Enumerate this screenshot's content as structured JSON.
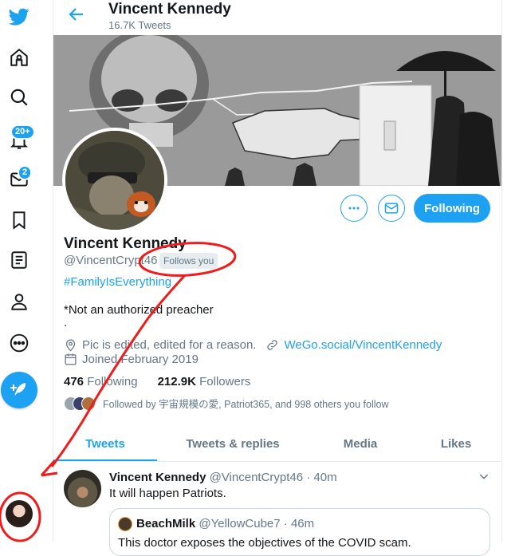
{
  "nav": {
    "notifications_badge": "20+",
    "messages_badge": "2"
  },
  "header": {
    "name": "Vincent Kennedy",
    "tweet_count": "16.7K Tweets"
  },
  "profile": {
    "name": "Vincent Kennedy",
    "handle": "@VincentCrypt46",
    "follows_you": "Follows you",
    "following_button": "Following",
    "hashtag": "#FamilyIsEverything",
    "bio_line1": "*Not an authorized preacher",
    "bio_line2": ".",
    "location": "Pic is edited, edited for a reason.",
    "website": "WeGo.social/VincentKennedy",
    "joined": "Joined February 2019",
    "following_count": "476",
    "following_label": "Following",
    "followers_count": "212.9K",
    "followers_label": "Followers",
    "followed_by": "Followed by 宇宙規模の愛, Patriot365, and 998 others you follow"
  },
  "tabs": [
    {
      "label": "Tweets"
    },
    {
      "label": "Tweets & replies"
    },
    {
      "label": "Media"
    },
    {
      "label": "Likes"
    }
  ],
  "tweet": {
    "name": "Vincent Kennedy",
    "handle_time": "@VincentCrypt46 · 40m",
    "text": "It will happen Patriots.",
    "quote": {
      "name": "BeachMilk",
      "handle_time": "@YellowCube7 · 46m",
      "text": "This doctor exposes the objectives of the COVID scam."
    }
  },
  "colors": {
    "accent": "#1da1f2",
    "annotation": "#ee1c1c"
  }
}
